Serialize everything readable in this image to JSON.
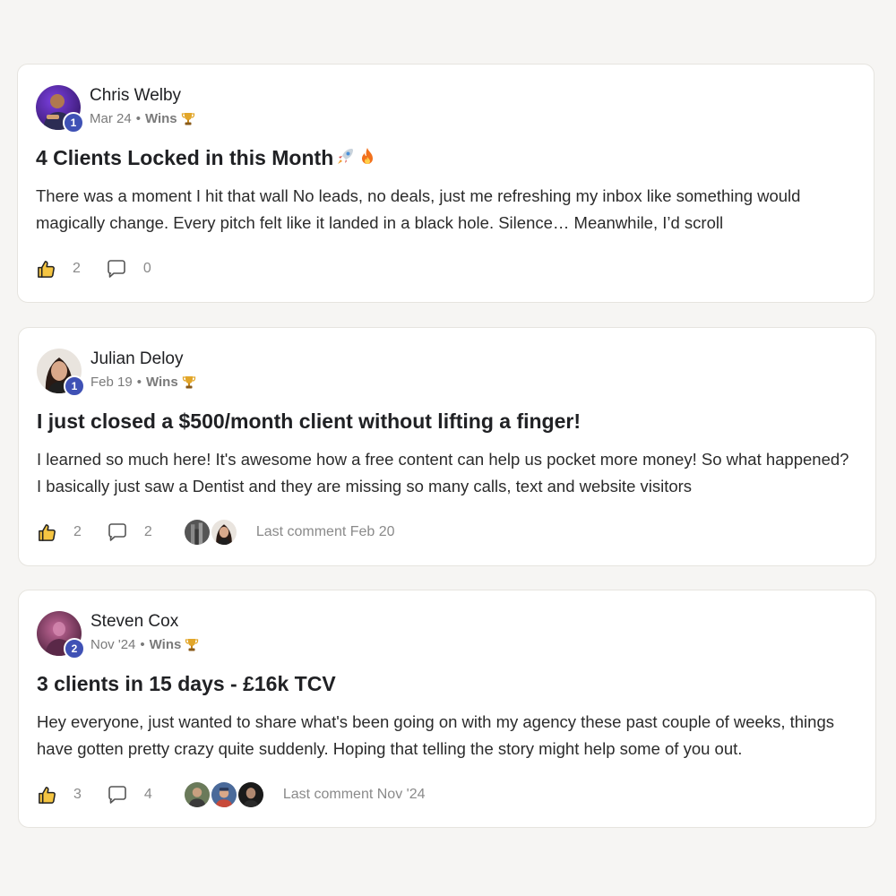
{
  "posts": [
    {
      "author": "Chris Welby",
      "level": "1",
      "date": "Mar 24",
      "separator": "•",
      "category": "Wins",
      "category_icon": "trophy-icon",
      "title": "4 Clients Locked in this Month",
      "title_emojis": [
        "rocket-icon",
        "fire-icon"
      ],
      "body": "There was a moment I hit that wall No leads, no deals, just me refreshing my inbox like something would magically change. Every pitch felt like it landed in a black hole. Silence… Meanwhile, I’d scroll",
      "likes": "2",
      "comments": "0",
      "last_comment": ""
    },
    {
      "author": "Julian Deloy",
      "level": "1",
      "date": "Feb 19",
      "separator": "•",
      "category": "Wins",
      "category_icon": "trophy-icon",
      "title": "I just closed a $500/month client without lifting a finger!",
      "title_emojis": [],
      "body": "I learned so much here! It's awesome how a free content can help us pocket more money! So what happened? I basically just saw a Dentist and they are missing so many calls, text and website visitors",
      "likes": "2",
      "comments": "2",
      "last_comment": "Last comment Feb 20"
    },
    {
      "author": "Steven Cox",
      "level": "2",
      "date": "Nov '24",
      "separator": "•",
      "category": "Wins",
      "category_icon": "trophy-icon",
      "title": "3 clients in 15 days - £16k TCV",
      "title_emojis": [],
      "body": "Hey everyone, just wanted to share what's been going on with my agency these past couple of weeks, things have gotten pretty crazy quite suddenly. Hoping that telling the story might help some of you out.",
      "likes": "3",
      "comments": "4",
      "last_comment": "Last comment Nov '24"
    }
  ],
  "colors": {
    "background": "#f6f5f3",
    "card": "#ffffff",
    "level_badge": "#3f51b5",
    "muted_text": "#7a7a7a"
  }
}
